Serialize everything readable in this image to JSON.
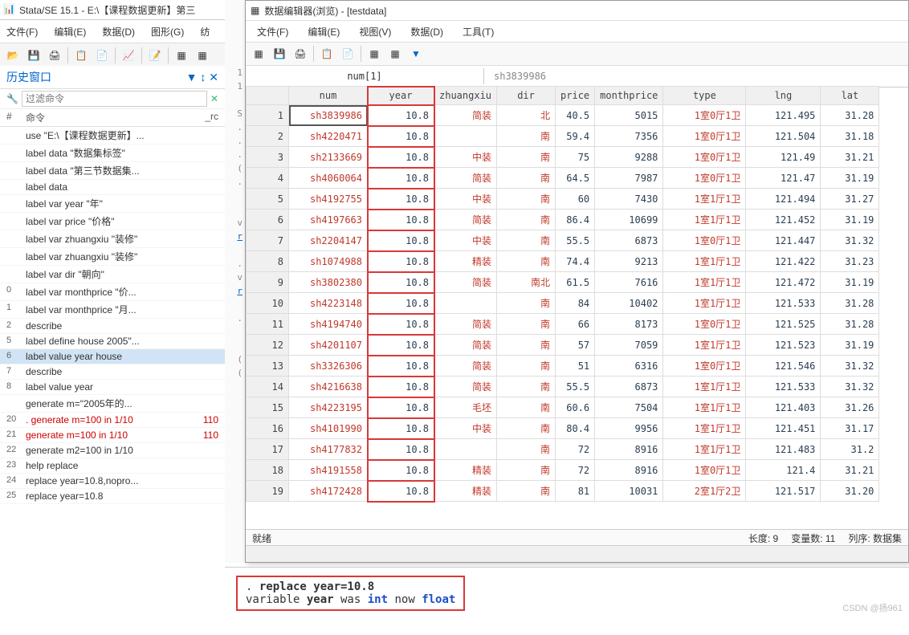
{
  "main_title": "Stata/SE 15.1 - E:\\【课程数据更新】第三",
  "main_menu": [
    "文件(F)",
    "编辑(E)",
    "数据(D)",
    "图形(G)",
    "纺"
  ],
  "history": {
    "title": "历史窗口",
    "filter_placeholder": "过滤命令",
    "head": {
      "num": "#",
      "cmd": "命令",
      "rc": "_rc"
    },
    "rows": [
      {
        "n": "",
        "cmd": "use \"E:\\【课程数据更新】...",
        "rc": ""
      },
      {
        "n": "",
        "cmd": "label data \"数据集标签\"",
        "rc": ""
      },
      {
        "n": "",
        "cmd": "label data \"第三节数据集...",
        "rc": ""
      },
      {
        "n": "",
        "cmd": "label data",
        "rc": ""
      },
      {
        "n": "",
        "cmd": "label var year \"年\"",
        "rc": ""
      },
      {
        "n": "",
        "cmd": "label var price \"价格\"",
        "rc": ""
      },
      {
        "n": "",
        "cmd": "label var zhuangxiu \"装修\"",
        "rc": ""
      },
      {
        "n": "",
        "cmd": "label var zhuangxiu \"装修\"",
        "rc": ""
      },
      {
        "n": "",
        "cmd": "label var dir \"朝向\"",
        "rc": ""
      },
      {
        "n": "0",
        "cmd": "label var monthprice \"价...",
        "rc": ""
      },
      {
        "n": "1",
        "cmd": "label var monthprice \"月...",
        "rc": ""
      },
      {
        "n": "2",
        "cmd": "describe",
        "rc": ""
      },
      {
        "n": "5",
        "cmd": "label define house 2005\"...",
        "rc": ""
      },
      {
        "n": "6",
        "cmd": "label value year house",
        "rc": "",
        "sel": true
      },
      {
        "n": "7",
        "cmd": "describe",
        "rc": ""
      },
      {
        "n": "8",
        "cmd": "label value year",
        "rc": ""
      },
      {
        "n": "",
        "cmd": "generate m=\"2005年的...",
        "rc": ""
      },
      {
        "n": "20",
        "cmd": ". generate m=100 in 1/10",
        "rc": "110",
        "err": true
      },
      {
        "n": "21",
        "cmd": "generate m=100 in 1/10",
        "rc": "110",
        "err": true
      },
      {
        "n": "22",
        "cmd": "generate m2=100 in 1/10",
        "rc": ""
      },
      {
        "n": "23",
        "cmd": "help replace",
        "rc": ""
      },
      {
        "n": "24",
        "cmd": "replace year=10.8,nopro...",
        "rc": ""
      },
      {
        "n": "25",
        "cmd": "replace year=10.8",
        "rc": ""
      }
    ]
  },
  "editor": {
    "title": "数据编辑器(浏览) - [testdata]",
    "menu": [
      "文件(F)",
      "编辑(E)",
      "视图(V)",
      "数据(D)",
      "工具(T)"
    ],
    "cell_ref": "num[1]",
    "cell_val": "sh3839986",
    "cols": [
      "num",
      "year",
      "zhuangxiu",
      "dir",
      "price",
      "monthprice",
      "type",
      "lng",
      "lat"
    ],
    "rows": [
      [
        "sh3839986",
        "10.8",
        "简装",
        "北",
        "40.5",
        "5015",
        "1室0厅1卫",
        "121.495",
        "31.28"
      ],
      [
        "sh4220471",
        "10.8",
        "",
        "南",
        "59.4",
        "7356",
        "1室0厅1卫",
        "121.504",
        "31.18"
      ],
      [
        "sh2133669",
        "10.8",
        "中装",
        "南",
        "75",
        "9288",
        "1室0厅1卫",
        "121.49",
        "31.21"
      ],
      [
        "sh4060064",
        "10.8",
        "简装",
        "南",
        "64.5",
        "7987",
        "1室0厅1卫",
        "121.47",
        "31.19"
      ],
      [
        "sh4192755",
        "10.8",
        "中装",
        "南",
        "60",
        "7430",
        "1室1厅1卫",
        "121.494",
        "31.27"
      ],
      [
        "sh4197663",
        "10.8",
        "简装",
        "南",
        "86.4",
        "10699",
        "1室1厅1卫",
        "121.452",
        "31.19"
      ],
      [
        "sh2204147",
        "10.8",
        "中装",
        "南",
        "55.5",
        "6873",
        "1室0厅1卫",
        "121.447",
        "31.32"
      ],
      [
        "sh1074988",
        "10.8",
        "精装",
        "南",
        "74.4",
        "9213",
        "1室1厅1卫",
        "121.422",
        "31.23"
      ],
      [
        "sh3802380",
        "10.8",
        "简装",
        "南北",
        "61.5",
        "7616",
        "1室1厅1卫",
        "121.472",
        "31.19"
      ],
      [
        "sh4223148",
        "10.8",
        "",
        "南",
        "84",
        "10402",
        "1室1厅1卫",
        "121.533",
        "31.28"
      ],
      [
        "sh4194740",
        "10.8",
        "简装",
        "南",
        "66",
        "8173",
        "1室0厅1卫",
        "121.525",
        "31.28"
      ],
      [
        "sh4201107",
        "10.8",
        "简装",
        "南",
        "57",
        "7059",
        "1室1厅1卫",
        "121.523",
        "31.19"
      ],
      [
        "sh3326306",
        "10.8",
        "简装",
        "南",
        "51",
        "6316",
        "1室0厅1卫",
        "121.546",
        "31.32"
      ],
      [
        "sh4216638",
        "10.8",
        "简装",
        "南",
        "55.5",
        "6873",
        "1室1厅1卫",
        "121.533",
        "31.32"
      ],
      [
        "sh4223195",
        "10.8",
        "毛坯",
        "南",
        "60.6",
        "7504",
        "1室1厅1卫",
        "121.403",
        "31.26"
      ],
      [
        "sh4101990",
        "10.8",
        "中装",
        "南",
        "80.4",
        "9956",
        "1室1厅1卫",
        "121.451",
        "31.17"
      ],
      [
        "sh4177832",
        "10.8",
        "",
        "南",
        "72",
        "8916",
        "1室1厅1卫",
        "121.483",
        "31.2"
      ],
      [
        "sh4191558",
        "10.8",
        "精装",
        "南",
        "72",
        "8916",
        "1室0厅1卫",
        "121.4",
        "31.21"
      ],
      [
        "sh4172428",
        "10.8",
        "精装",
        "南",
        "81",
        "10031",
        "2室1厅2卫",
        "121.517",
        "31.20"
      ]
    ],
    "status": {
      "ready": "就绪",
      "len": "长度: 9",
      "vars": "变量数: 11",
      "order": "列序: 数据集"
    }
  },
  "output": {
    "l1_a": ". ",
    "l1_b": "replace year=10.8",
    "l2_a": "variable ",
    "l2_b": "year",
    "l2_c": " was ",
    "l2_d": "int",
    "l2_e": " now ",
    "l2_f": "float"
  },
  "watermark": "CSDN @扬961"
}
